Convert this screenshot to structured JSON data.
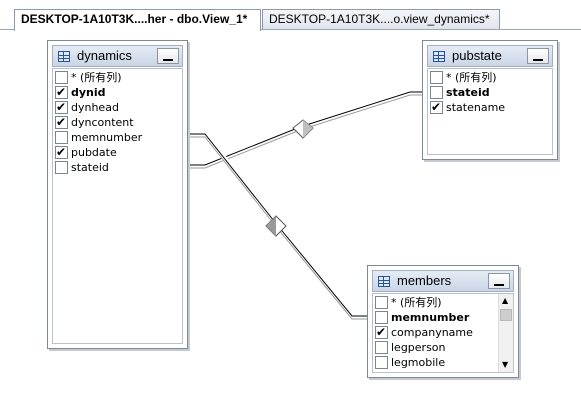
{
  "tabs": [
    {
      "label": "DESKTOP-1A10T3K....her - dbo.View_1*",
      "active": true
    },
    {
      "label": "DESKTOP-1A10T3K....o.view_dynamics*",
      "active": false
    }
  ],
  "tables": {
    "dynamics": {
      "title": "dynamics",
      "columns": [
        {
          "label": "* (所有列)",
          "checked": false,
          "key": false
        },
        {
          "label": "dynid",
          "checked": true,
          "key": true
        },
        {
          "label": "dynhead",
          "checked": true,
          "key": false
        },
        {
          "label": "dyncontent",
          "checked": true,
          "key": false
        },
        {
          "label": "memnumber",
          "checked": false,
          "key": false
        },
        {
          "label": "pubdate",
          "checked": true,
          "key": false
        },
        {
          "label": "stateid",
          "checked": false,
          "key": false
        }
      ]
    },
    "pubstate": {
      "title": "pubstate",
      "columns": [
        {
          "label": "* (所有列)",
          "checked": false,
          "key": false
        },
        {
          "label": "stateid",
          "checked": false,
          "key": true
        },
        {
          "label": "statename",
          "checked": true,
          "key": false
        }
      ]
    },
    "members": {
      "title": "members",
      "columns": [
        {
          "label": "* (所有列)",
          "checked": false,
          "key": false
        },
        {
          "label": "memnumber",
          "checked": false,
          "key": true
        },
        {
          "label": "companyname",
          "checked": true,
          "key": false
        },
        {
          "label": "legperson",
          "checked": false,
          "key": false
        },
        {
          "label": "legmobile",
          "checked": false,
          "key": false
        }
      ]
    }
  },
  "icons": {
    "table": "table-icon",
    "minimize": "minimize-icon",
    "join": "join-diamond-icon",
    "scroll_up": "scroll-up-arrow-icon",
    "scroll_down": "scroll-down-arrow-icon"
  },
  "colors": {
    "header_gradient_top": "#e6ecf5",
    "header_gradient_bottom": "#c9d5e6",
    "link_line": "#000000"
  }
}
